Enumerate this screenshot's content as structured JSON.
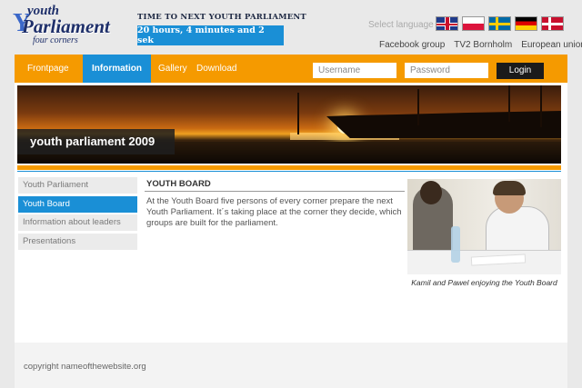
{
  "logo": {
    "line1": "youth",
    "line2": "Parliament",
    "line3": "four corners",
    "letter_y": "Y"
  },
  "countdown": {
    "title": "TIME TO NEXT YOUTH PARLIAMENT",
    "value": "20 hours, 4 minutes and 2 sek"
  },
  "language": {
    "label": "Select language",
    "flags": [
      "flag-uk-icon",
      "flag-poland-icon",
      "flag-sweden-icon",
      "flag-germany-icon",
      "flag-denmark-icon"
    ]
  },
  "top_links": [
    "Facebook group",
    "TV2 Bornholm",
    "European union"
  ],
  "nav": {
    "items": [
      "Frontpage",
      "Information",
      "Gallery",
      "Download"
    ],
    "active": "Information"
  },
  "login": {
    "username_placeholder": "Username",
    "password_placeholder": "Password",
    "button": "Login"
  },
  "banner": {
    "title": "youth parliament 2009"
  },
  "sidebar": {
    "items": [
      "Youth Parliament",
      "Youth Board",
      "Information about leaders",
      "Presentations"
    ],
    "active": "Youth Board"
  },
  "content": {
    "title": "YOUTH BOARD",
    "body": "At the Youth Board five persons of every corner prepare the next Youth Parliament. It´s taking place at the corner they decide, which groups are built for the parliament."
  },
  "photo": {
    "caption": "Kamil and Pawel enjoying the Youth Board"
  },
  "footer": {
    "text": "copyright nameofthewebsite.org"
  },
  "colors": {
    "orange": "#f59a00",
    "blue": "#1a8fd6",
    "dark": "#1b1b1b"
  }
}
